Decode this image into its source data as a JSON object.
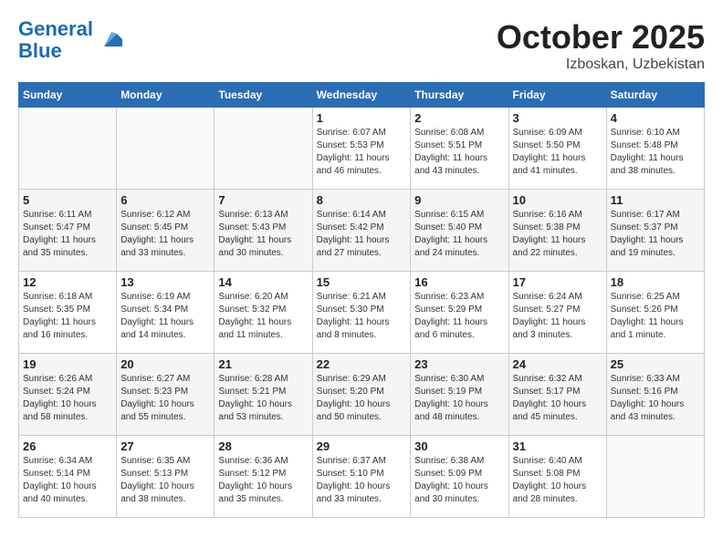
{
  "logo": {
    "line1": "General",
    "line2": "Blue"
  },
  "title": "October 2025",
  "subtitle": "Izboskan, Uzbekistan",
  "days_of_week": [
    "Sunday",
    "Monday",
    "Tuesday",
    "Wednesday",
    "Thursday",
    "Friday",
    "Saturday"
  ],
  "weeks": [
    [
      {
        "day": "",
        "info": ""
      },
      {
        "day": "",
        "info": ""
      },
      {
        "day": "",
        "info": ""
      },
      {
        "day": "1",
        "info": "Sunrise: 6:07 AM\nSunset: 5:53 PM\nDaylight: 11 hours and 46 minutes."
      },
      {
        "day": "2",
        "info": "Sunrise: 6:08 AM\nSunset: 5:51 PM\nDaylight: 11 hours and 43 minutes."
      },
      {
        "day": "3",
        "info": "Sunrise: 6:09 AM\nSunset: 5:50 PM\nDaylight: 11 hours and 41 minutes."
      },
      {
        "day": "4",
        "info": "Sunrise: 6:10 AM\nSunset: 5:48 PM\nDaylight: 11 hours and 38 minutes."
      }
    ],
    [
      {
        "day": "5",
        "info": "Sunrise: 6:11 AM\nSunset: 5:47 PM\nDaylight: 11 hours and 35 minutes."
      },
      {
        "day": "6",
        "info": "Sunrise: 6:12 AM\nSunset: 5:45 PM\nDaylight: 11 hours and 33 minutes."
      },
      {
        "day": "7",
        "info": "Sunrise: 6:13 AM\nSunset: 5:43 PM\nDaylight: 11 hours and 30 minutes."
      },
      {
        "day": "8",
        "info": "Sunrise: 6:14 AM\nSunset: 5:42 PM\nDaylight: 11 hours and 27 minutes."
      },
      {
        "day": "9",
        "info": "Sunrise: 6:15 AM\nSunset: 5:40 PM\nDaylight: 11 hours and 24 minutes."
      },
      {
        "day": "10",
        "info": "Sunrise: 6:16 AM\nSunset: 5:38 PM\nDaylight: 11 hours and 22 minutes."
      },
      {
        "day": "11",
        "info": "Sunrise: 6:17 AM\nSunset: 5:37 PM\nDaylight: 11 hours and 19 minutes."
      }
    ],
    [
      {
        "day": "12",
        "info": "Sunrise: 6:18 AM\nSunset: 5:35 PM\nDaylight: 11 hours and 16 minutes."
      },
      {
        "day": "13",
        "info": "Sunrise: 6:19 AM\nSunset: 5:34 PM\nDaylight: 11 hours and 14 minutes."
      },
      {
        "day": "14",
        "info": "Sunrise: 6:20 AM\nSunset: 5:32 PM\nDaylight: 11 hours and 11 minutes."
      },
      {
        "day": "15",
        "info": "Sunrise: 6:21 AM\nSunset: 5:30 PM\nDaylight: 11 hours and 8 minutes."
      },
      {
        "day": "16",
        "info": "Sunrise: 6:23 AM\nSunset: 5:29 PM\nDaylight: 11 hours and 6 minutes."
      },
      {
        "day": "17",
        "info": "Sunrise: 6:24 AM\nSunset: 5:27 PM\nDaylight: 11 hours and 3 minutes."
      },
      {
        "day": "18",
        "info": "Sunrise: 6:25 AM\nSunset: 5:26 PM\nDaylight: 11 hours and 1 minute."
      }
    ],
    [
      {
        "day": "19",
        "info": "Sunrise: 6:26 AM\nSunset: 5:24 PM\nDaylight: 10 hours and 58 minutes."
      },
      {
        "day": "20",
        "info": "Sunrise: 6:27 AM\nSunset: 5:23 PM\nDaylight: 10 hours and 55 minutes."
      },
      {
        "day": "21",
        "info": "Sunrise: 6:28 AM\nSunset: 5:21 PM\nDaylight: 10 hours and 53 minutes."
      },
      {
        "day": "22",
        "info": "Sunrise: 6:29 AM\nSunset: 5:20 PM\nDaylight: 10 hours and 50 minutes."
      },
      {
        "day": "23",
        "info": "Sunrise: 6:30 AM\nSunset: 5:19 PM\nDaylight: 10 hours and 48 minutes."
      },
      {
        "day": "24",
        "info": "Sunrise: 6:32 AM\nSunset: 5:17 PM\nDaylight: 10 hours and 45 minutes."
      },
      {
        "day": "25",
        "info": "Sunrise: 6:33 AM\nSunset: 5:16 PM\nDaylight: 10 hours and 43 minutes."
      }
    ],
    [
      {
        "day": "26",
        "info": "Sunrise: 6:34 AM\nSunset: 5:14 PM\nDaylight: 10 hours and 40 minutes."
      },
      {
        "day": "27",
        "info": "Sunrise: 6:35 AM\nSunset: 5:13 PM\nDaylight: 10 hours and 38 minutes."
      },
      {
        "day": "28",
        "info": "Sunrise: 6:36 AM\nSunset: 5:12 PM\nDaylight: 10 hours and 35 minutes."
      },
      {
        "day": "29",
        "info": "Sunrise: 6:37 AM\nSunset: 5:10 PM\nDaylight: 10 hours and 33 minutes."
      },
      {
        "day": "30",
        "info": "Sunrise: 6:38 AM\nSunset: 5:09 PM\nDaylight: 10 hours and 30 minutes."
      },
      {
        "day": "31",
        "info": "Sunrise: 6:40 AM\nSunset: 5:08 PM\nDaylight: 10 hours and 28 minutes."
      },
      {
        "day": "",
        "info": ""
      }
    ]
  ]
}
